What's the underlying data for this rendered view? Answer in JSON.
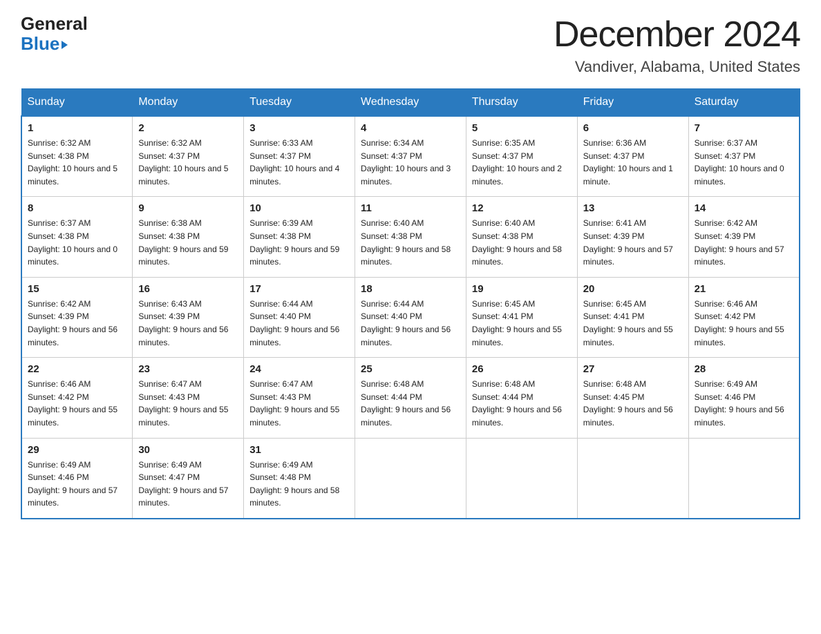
{
  "header": {
    "logo_line1": "General",
    "logo_line2": "Blue",
    "title": "December 2024",
    "location": "Vandiver, Alabama, United States"
  },
  "days_header": [
    "Sunday",
    "Monday",
    "Tuesday",
    "Wednesday",
    "Thursday",
    "Friday",
    "Saturday"
  ],
  "weeks": [
    [
      {
        "num": "1",
        "sunrise": "6:32 AM",
        "sunset": "4:38 PM",
        "daylight": "10 hours and 5 minutes."
      },
      {
        "num": "2",
        "sunrise": "6:32 AM",
        "sunset": "4:37 PM",
        "daylight": "10 hours and 5 minutes."
      },
      {
        "num": "3",
        "sunrise": "6:33 AM",
        "sunset": "4:37 PM",
        "daylight": "10 hours and 4 minutes."
      },
      {
        "num": "4",
        "sunrise": "6:34 AM",
        "sunset": "4:37 PM",
        "daylight": "10 hours and 3 minutes."
      },
      {
        "num": "5",
        "sunrise": "6:35 AM",
        "sunset": "4:37 PM",
        "daylight": "10 hours and 2 minutes."
      },
      {
        "num": "6",
        "sunrise": "6:36 AM",
        "sunset": "4:37 PM",
        "daylight": "10 hours and 1 minute."
      },
      {
        "num": "7",
        "sunrise": "6:37 AM",
        "sunset": "4:37 PM",
        "daylight": "10 hours and 0 minutes."
      }
    ],
    [
      {
        "num": "8",
        "sunrise": "6:37 AM",
        "sunset": "4:38 PM",
        "daylight": "10 hours and 0 minutes."
      },
      {
        "num": "9",
        "sunrise": "6:38 AM",
        "sunset": "4:38 PM",
        "daylight": "9 hours and 59 minutes."
      },
      {
        "num": "10",
        "sunrise": "6:39 AM",
        "sunset": "4:38 PM",
        "daylight": "9 hours and 59 minutes."
      },
      {
        "num": "11",
        "sunrise": "6:40 AM",
        "sunset": "4:38 PM",
        "daylight": "9 hours and 58 minutes."
      },
      {
        "num": "12",
        "sunrise": "6:40 AM",
        "sunset": "4:38 PM",
        "daylight": "9 hours and 58 minutes."
      },
      {
        "num": "13",
        "sunrise": "6:41 AM",
        "sunset": "4:39 PM",
        "daylight": "9 hours and 57 minutes."
      },
      {
        "num": "14",
        "sunrise": "6:42 AM",
        "sunset": "4:39 PM",
        "daylight": "9 hours and 57 minutes."
      }
    ],
    [
      {
        "num": "15",
        "sunrise": "6:42 AM",
        "sunset": "4:39 PM",
        "daylight": "9 hours and 56 minutes."
      },
      {
        "num": "16",
        "sunrise": "6:43 AM",
        "sunset": "4:39 PM",
        "daylight": "9 hours and 56 minutes."
      },
      {
        "num": "17",
        "sunrise": "6:44 AM",
        "sunset": "4:40 PM",
        "daylight": "9 hours and 56 minutes."
      },
      {
        "num": "18",
        "sunrise": "6:44 AM",
        "sunset": "4:40 PM",
        "daylight": "9 hours and 56 minutes."
      },
      {
        "num": "19",
        "sunrise": "6:45 AM",
        "sunset": "4:41 PM",
        "daylight": "9 hours and 55 minutes."
      },
      {
        "num": "20",
        "sunrise": "6:45 AM",
        "sunset": "4:41 PM",
        "daylight": "9 hours and 55 minutes."
      },
      {
        "num": "21",
        "sunrise": "6:46 AM",
        "sunset": "4:42 PM",
        "daylight": "9 hours and 55 minutes."
      }
    ],
    [
      {
        "num": "22",
        "sunrise": "6:46 AM",
        "sunset": "4:42 PM",
        "daylight": "9 hours and 55 minutes."
      },
      {
        "num": "23",
        "sunrise": "6:47 AM",
        "sunset": "4:43 PM",
        "daylight": "9 hours and 55 minutes."
      },
      {
        "num": "24",
        "sunrise": "6:47 AM",
        "sunset": "4:43 PM",
        "daylight": "9 hours and 55 minutes."
      },
      {
        "num": "25",
        "sunrise": "6:48 AM",
        "sunset": "4:44 PM",
        "daylight": "9 hours and 56 minutes."
      },
      {
        "num": "26",
        "sunrise": "6:48 AM",
        "sunset": "4:44 PM",
        "daylight": "9 hours and 56 minutes."
      },
      {
        "num": "27",
        "sunrise": "6:48 AM",
        "sunset": "4:45 PM",
        "daylight": "9 hours and 56 minutes."
      },
      {
        "num": "28",
        "sunrise": "6:49 AM",
        "sunset": "4:46 PM",
        "daylight": "9 hours and 56 minutes."
      }
    ],
    [
      {
        "num": "29",
        "sunrise": "6:49 AM",
        "sunset": "4:46 PM",
        "daylight": "9 hours and 57 minutes."
      },
      {
        "num": "30",
        "sunrise": "6:49 AM",
        "sunset": "4:47 PM",
        "daylight": "9 hours and 57 minutes."
      },
      {
        "num": "31",
        "sunrise": "6:49 AM",
        "sunset": "4:48 PM",
        "daylight": "9 hours and 58 minutes."
      },
      null,
      null,
      null,
      null
    ]
  ],
  "labels": {
    "sunrise": "Sunrise:",
    "sunset": "Sunset:",
    "daylight": "Daylight:"
  }
}
